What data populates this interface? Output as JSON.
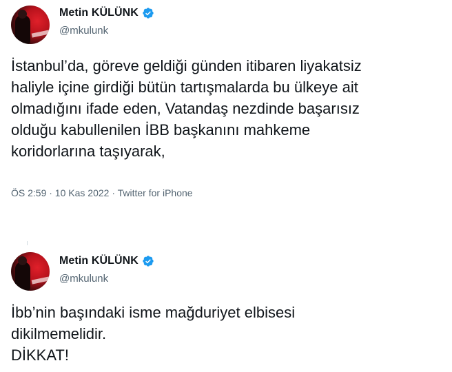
{
  "tweets": [
    {
      "author": {
        "display_name": "Metin KÜLÜNK",
        "handle": "@mkulunk",
        "verified": true
      },
      "text": "İstanbul’da, göreve geldiği günden itibaren liyakatsiz\nhaliyle içine girdiği bütün tartışmalarda bu ülkeye ait\nolmadığını ifade eden, Vatandaş nezdinde başarısız\nolduğu kabullenilen İBB başkanını mahkeme\nkoridorlarına taşıyarak,",
      "meta": "ÖS 2:59 · 10 Kas 2022 · Twitter for iPhone"
    },
    {
      "author": {
        "display_name": "Metin KÜLÜNK",
        "handle": "@mkulunk",
        "verified": true
      },
      "text": "İbb’nin başındaki isme mağduriyet elbisesi\ndikilmemelidir.\nDİKKAT!"
    }
  ],
  "colors": {
    "verified_badge": "#1d9bf0",
    "secondary_text": "#536471",
    "primary_text": "#0f1419"
  }
}
